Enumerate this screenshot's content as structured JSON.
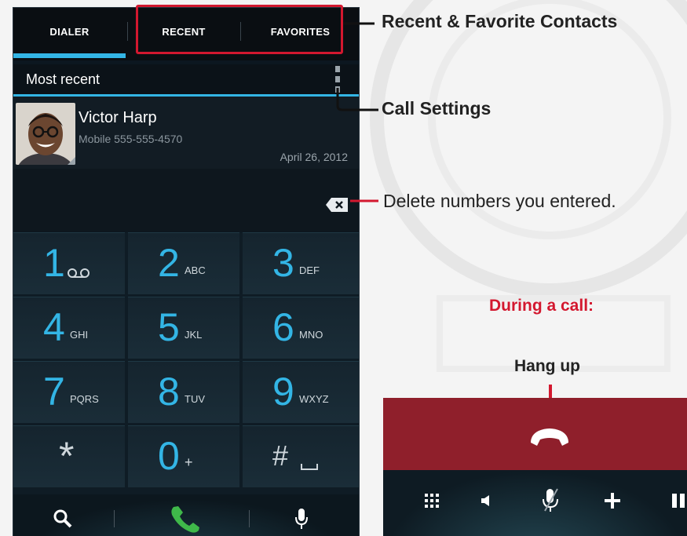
{
  "tabs": [
    {
      "label": "DIALER"
    },
    {
      "label": "RECENT"
    },
    {
      "label": "FAVORITES"
    }
  ],
  "section_title": "Most recent",
  "contact": {
    "name": "Victor Harp",
    "number": "Mobile 555-555-4570",
    "date": "April 26, 2012"
  },
  "keys": [
    {
      "digit": "1",
      "letters": ""
    },
    {
      "digit": "2",
      "letters": "ABC"
    },
    {
      "digit": "3",
      "letters": "DEF"
    },
    {
      "digit": "4",
      "letters": "GHI"
    },
    {
      "digit": "5",
      "letters": "JKL"
    },
    {
      "digit": "6",
      "letters": "MNO"
    },
    {
      "digit": "7",
      "letters": "PQRS"
    },
    {
      "digit": "8",
      "letters": "TUV"
    },
    {
      "digit": "9",
      "letters": "WXYZ"
    },
    {
      "digit": "*",
      "letters": ""
    },
    {
      "digit": "0",
      "letters": "+"
    },
    {
      "digit": "#",
      "letters": ""
    }
  ],
  "callouts": {
    "recent_favorites": "Recent & Favorite Contacts",
    "call_settings": "Call Settings",
    "delete_numbers": "Delete numbers you entered.",
    "during_call": "During a call:",
    "hang_up": "Hang up"
  },
  "colors": {
    "accent": "#33b5e5",
    "callout_red": "#d3182f",
    "hangup_bar": "#8f1f2b",
    "call_green": "#3fb84a"
  },
  "icons": [
    "search-icon",
    "phone-icon",
    "microphone-icon",
    "voicemail-icon",
    "delete-icon",
    "overflow-menu-icon",
    "hangup-icon",
    "dialpad-icon",
    "speaker-icon",
    "mute-icon",
    "add-call-icon",
    "pause-icon"
  ]
}
